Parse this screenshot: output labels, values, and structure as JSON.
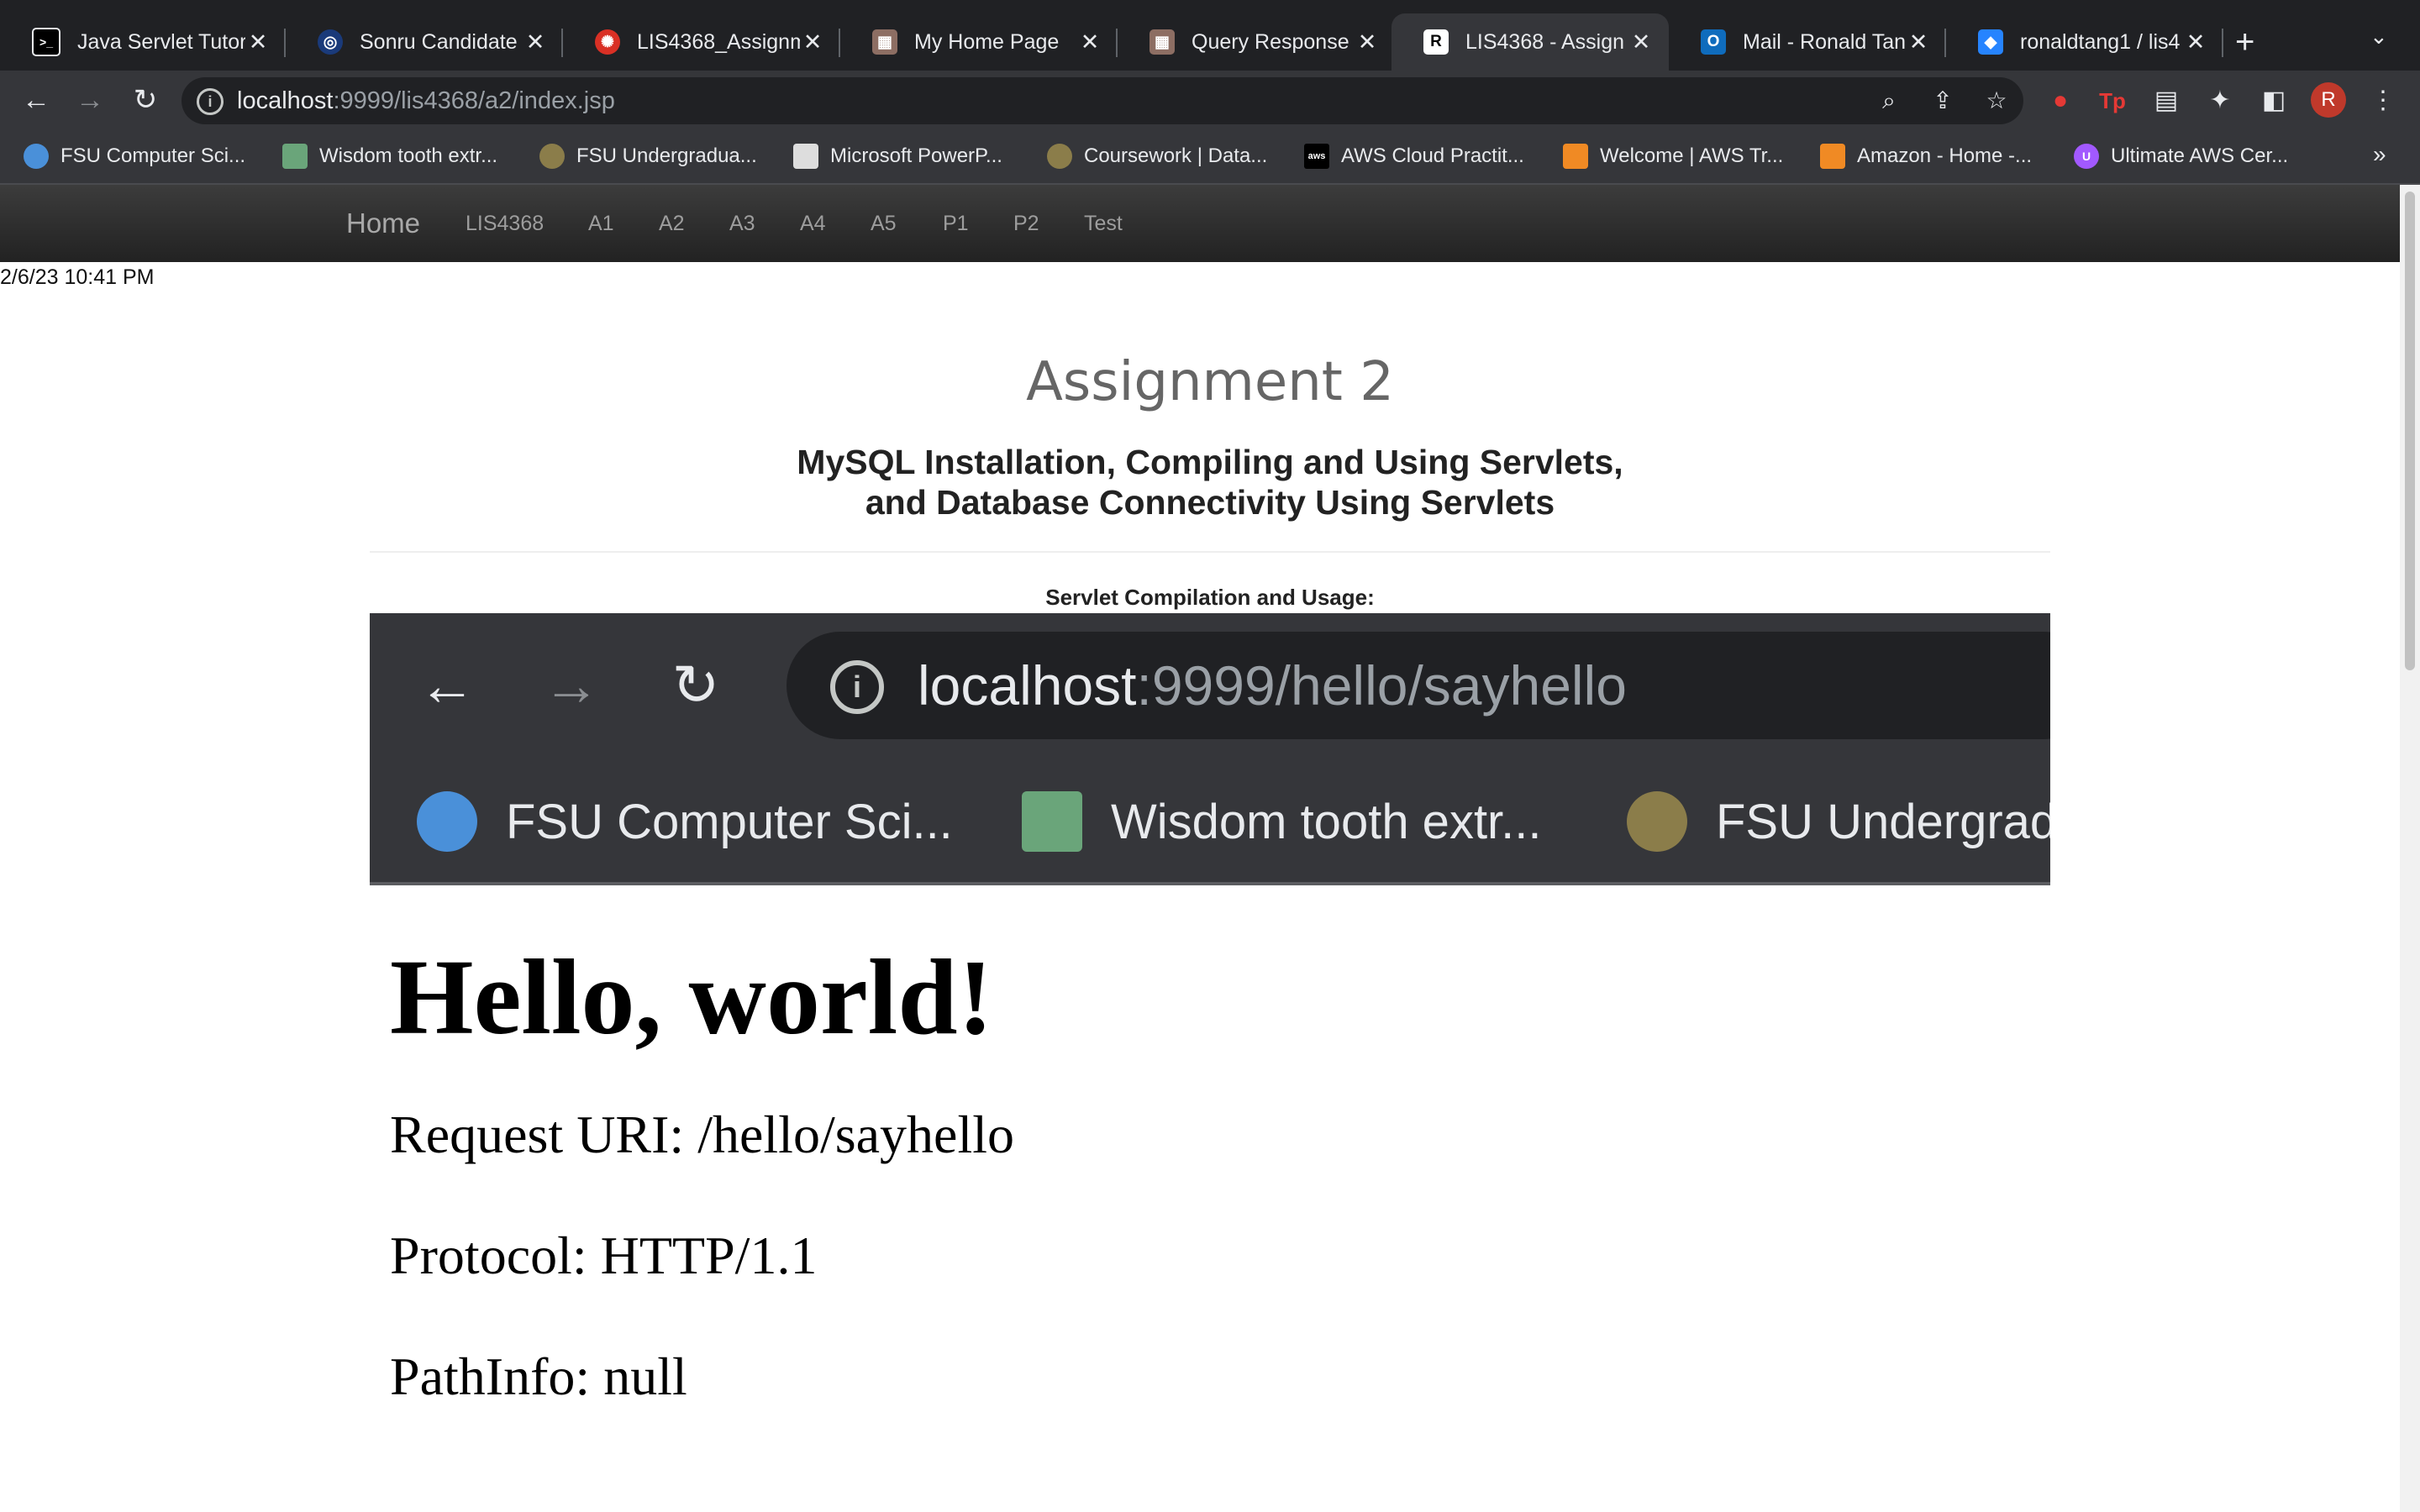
{
  "browser": {
    "tabs": [
      {
        "label": "Java Servlet Tutor",
        "favicon_color": "#000000",
        "favicon_glyph": ">_"
      },
      {
        "label": "Sonru Candidate",
        "favicon_color": "#1a3a7a",
        "favicon_glyph": "◎"
      },
      {
        "label": "LIS4368_Assignm",
        "favicon_color": "#d93025",
        "favicon_glyph": "✺"
      },
      {
        "label": "My Home Page",
        "favicon_color": "#8d6e63",
        "favicon_glyph": "▦"
      },
      {
        "label": "Query Response",
        "favicon_color": "#8d6e63",
        "favicon_glyph": "▦"
      },
      {
        "label": "LIS4368 - Assign",
        "favicon_color": "#ffffff",
        "favicon_glyph": "R"
      },
      {
        "label": "Mail - Ronald Tan",
        "favicon_color": "#0f6cbd",
        "favicon_glyph": "O"
      },
      {
        "label": "ronaldtang1 / lis4",
        "favicon_color": "#2684ff",
        "favicon_glyph": "◆"
      }
    ],
    "active_tab_index": 5,
    "new_tab_icon": "plus-icon",
    "address_bar": {
      "host": "localhost",
      "rest": ":9999/lis4368/a2/index.jsp"
    },
    "bookmarks": [
      {
        "label": "FSU Computer Sci...",
        "favicon_color": "#4a90d9"
      },
      {
        "label": "Wisdom tooth extr...",
        "favicon_color": "#6aa57a"
      },
      {
        "label": "FSU Undergradua...",
        "favicon_color": "#8b7d4a"
      },
      {
        "label": "Microsoft PowerP...",
        "favicon_color": "#dddddd"
      },
      {
        "label": "Coursework | Data...",
        "favicon_color": "#8b7d4a"
      },
      {
        "label": "AWS Cloud Practit...",
        "favicon_color": "#000000"
      },
      {
        "label": "Welcome | AWS Tr...",
        "favicon_color": "#f08a24"
      },
      {
        "label": "Amazon - Home -...",
        "favicon_color": "#f08a24"
      },
      {
        "label": "Ultimate AWS Cer...",
        "favicon_color": "#a259ff"
      }
    ],
    "profile_initial": "R"
  },
  "site_nav": {
    "brand": "Home",
    "items": [
      "LIS4368",
      "A1",
      "A2",
      "A3",
      "A4",
      "A5",
      "P1",
      "P2",
      "Test"
    ]
  },
  "page": {
    "timestamp": "2/6/23 10:41 PM",
    "title": "Assignment 2",
    "subtitle_line1": "MySQL Installation, Compiling and Using Servlets,",
    "subtitle_line2": "and Database Connectivity Using Servlets",
    "caption": "Servlet Compilation and Usage:"
  },
  "screenshot": {
    "address_host": "localhost",
    "address_rest": ":9999/hello/sayhello",
    "bookmarks": [
      "FSU Computer Sci...",
      "Wisdom tooth extr...",
      "FSU Undergrad"
    ],
    "heading": "Hello, world!",
    "lines": [
      "Request URI: /hello/sayhello",
      "Protocol: HTTP/1.1",
      "PathInfo: null"
    ]
  }
}
